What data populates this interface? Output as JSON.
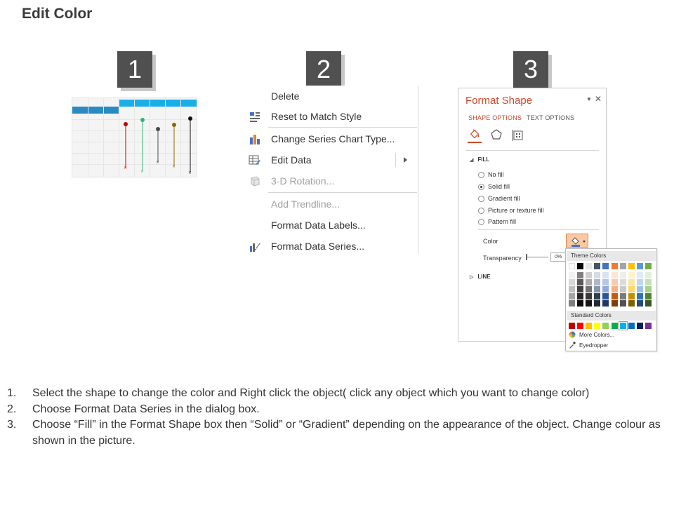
{
  "page": {
    "title": "Edit Color"
  },
  "steps": [
    "1",
    "2",
    "3"
  ],
  "mini_chart": {
    "header_colors": {
      "dark": "#2a8bc2",
      "light": "#1aaee8"
    },
    "series_colors": [
      "#c00000",
      "#2eb37a",
      "#4a4a4a",
      "#8a6a00",
      "#111111"
    ]
  },
  "context_menu": {
    "items": [
      {
        "label": "Delete",
        "icon": "none",
        "disabled": false
      },
      {
        "label": "Reset to Match Style",
        "icon": "reset-style-icon",
        "disabled": false
      },
      {
        "label": "Change Series Chart Type...",
        "icon": "chart-type-icon",
        "disabled": false
      },
      {
        "label": "Edit Data",
        "icon": "edit-data-icon",
        "disabled": false
      },
      {
        "label": "3-D Rotation...",
        "icon": "rotation-3d-icon",
        "disabled": true
      },
      {
        "label": "Add Trendline...",
        "icon": "none",
        "disabled": true
      },
      {
        "label": "Format Data Labels...",
        "icon": "none",
        "disabled": false
      },
      {
        "label": "Format Data Series...",
        "icon": "format-series-icon",
        "disabled": false
      }
    ]
  },
  "format_pane": {
    "title": "Format Shape",
    "tabs": {
      "shape_options": "SHAPE OPTIONS",
      "text_options": "TEXT OPTIONS"
    },
    "fill_section": "FILL",
    "fill_options": [
      {
        "label": "No fill",
        "checked": false
      },
      {
        "label": "Solid fill",
        "checked": true
      },
      {
        "label": "Gradient fill",
        "checked": false
      },
      {
        "label": "Picture or texture fill",
        "checked": false
      },
      {
        "label": "Pattern fill",
        "checked": false
      }
    ],
    "color_label": "Color",
    "transparency_label": "Transparency",
    "transparency_value": "0%",
    "line_section": "LINE",
    "accent_color": "#d24726"
  },
  "color_dropdown": {
    "theme_header": "Theme Colors",
    "standard_header": "Standard Colors",
    "more_colors": "More Colors...",
    "eyedropper": "Eyedropper",
    "theme_top": [
      "#ffffff",
      "#000000",
      "#e7e6e6",
      "#44546a",
      "#4472c4",
      "#ed7d31",
      "#a5a5a5",
      "#ffc000",
      "#5b9bd5",
      "#70ad47"
    ],
    "theme_shades": [
      [
        "#f2f2f2",
        "#7f7f7f",
        "#d0cece",
        "#d6dce4",
        "#d9e2f3",
        "#fbe5d5",
        "#ededed",
        "#fff2cc",
        "#deebf6",
        "#e2efd9"
      ],
      [
        "#d8d8d8",
        "#595959",
        "#aeabab",
        "#adb9ca",
        "#b4c6e7",
        "#f7cbac",
        "#dbdbdb",
        "#fee599",
        "#bdd7ee",
        "#c5e0b3"
      ],
      [
        "#bfbfbf",
        "#3f3f3f",
        "#757070",
        "#8496b0",
        "#8eaadb",
        "#f4b183",
        "#c9c9c9",
        "#ffd965",
        "#9cc3e5",
        "#a8d08d"
      ],
      [
        "#a5a5a5",
        "#262626",
        "#3a3838",
        "#323f4f",
        "#2f5496",
        "#c55a11",
        "#7b7b7b",
        "#bf9000",
        "#2e75b5",
        "#538135"
      ],
      [
        "#7f7f7f",
        "#0c0c0c",
        "#171616",
        "#222a35",
        "#1f3864",
        "#833c0b",
        "#525252",
        "#7f6000",
        "#1e4e79",
        "#375623"
      ]
    ],
    "standard": [
      "#c00000",
      "#ff0000",
      "#ffc000",
      "#ffff00",
      "#92d050",
      "#00b050",
      "#00b0f0",
      "#0070c0",
      "#002060",
      "#7030a0"
    ],
    "selected_standard_index": 6
  },
  "instructions": [
    {
      "num": "1.",
      "text": "Select the shape to change the color and Right click the object( click any object which you want to change color)"
    },
    {
      "num": "2.",
      "text": "Choose Format Data Series in the dialog box."
    },
    {
      "num": "3.",
      "text": "Choose “Fill” in the Format Shape box then “Solid” or “Gradient” depending on the appearance of the object. Change colour as shown in the picture."
    }
  ]
}
